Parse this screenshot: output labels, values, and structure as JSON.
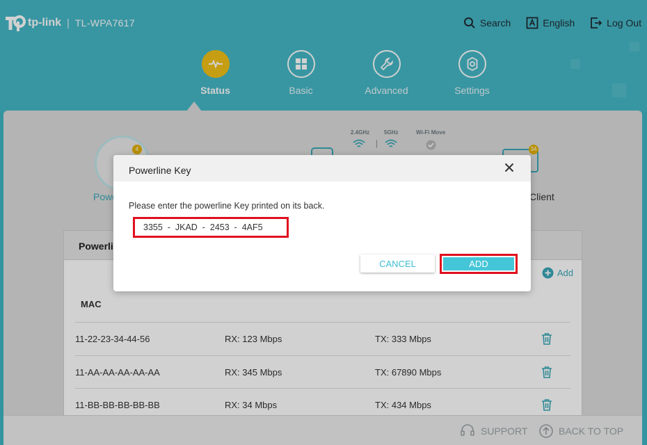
{
  "header": {
    "brand": "tp-link",
    "model": "TL-WPA7617",
    "topnav": [
      {
        "label": "Search",
        "icon": "search-icon"
      },
      {
        "label": "English",
        "icon": "language-icon"
      },
      {
        "label": "Log Out",
        "icon": "logout-icon"
      }
    ],
    "mainnav": [
      {
        "label": "Status",
        "icon": "pulse-icon",
        "active": true
      },
      {
        "label": "Basic",
        "icon": "grid-icon"
      },
      {
        "label": "Advanced",
        "icon": "wrench-icon"
      },
      {
        "label": "Settings",
        "icon": "gear-icon"
      }
    ]
  },
  "status": {
    "band_24": "2.4GHz",
    "band_5": "5GHz",
    "wifi_move": "Wi-Fi Move",
    "powerline_badge": "4",
    "powerline_label": "Powe",
    "client_badge": "34",
    "client_label": "Client"
  },
  "panel": {
    "title": "Powerli",
    "add_label": "Add",
    "mac_header": "MAC",
    "rows": [
      {
        "mac": "11-22-23-34-44-56",
        "rx": "RX: 123 Mbps",
        "tx": "TX: 333 Mbps"
      },
      {
        "mac": "11-AA-AA-AA-AA-AA",
        "rx": "RX: 345 Mbps",
        "tx": "TX: 67890 Mbps"
      },
      {
        "mac": "11-BB-BB-BB-BB-BB",
        "rx": "RX: 34 Mbps",
        "tx": "TX: 434 Mbps"
      }
    ]
  },
  "footer": {
    "support": "SUPPORT",
    "back_to_top": "BACK TO TOP"
  },
  "modal": {
    "title": "Powerline Key",
    "prompt": "Please enter the powerline Key printed on its back.",
    "key_value": "3355  -  JKAD  -  2453  -  4AF5",
    "cancel_label": "CANCEL",
    "add_label": "ADD"
  },
  "colors": {
    "accent": "#45b8c6",
    "active_nav": "#f2c118",
    "highlight": "#e0101e",
    "button": "#45c6d8"
  }
}
